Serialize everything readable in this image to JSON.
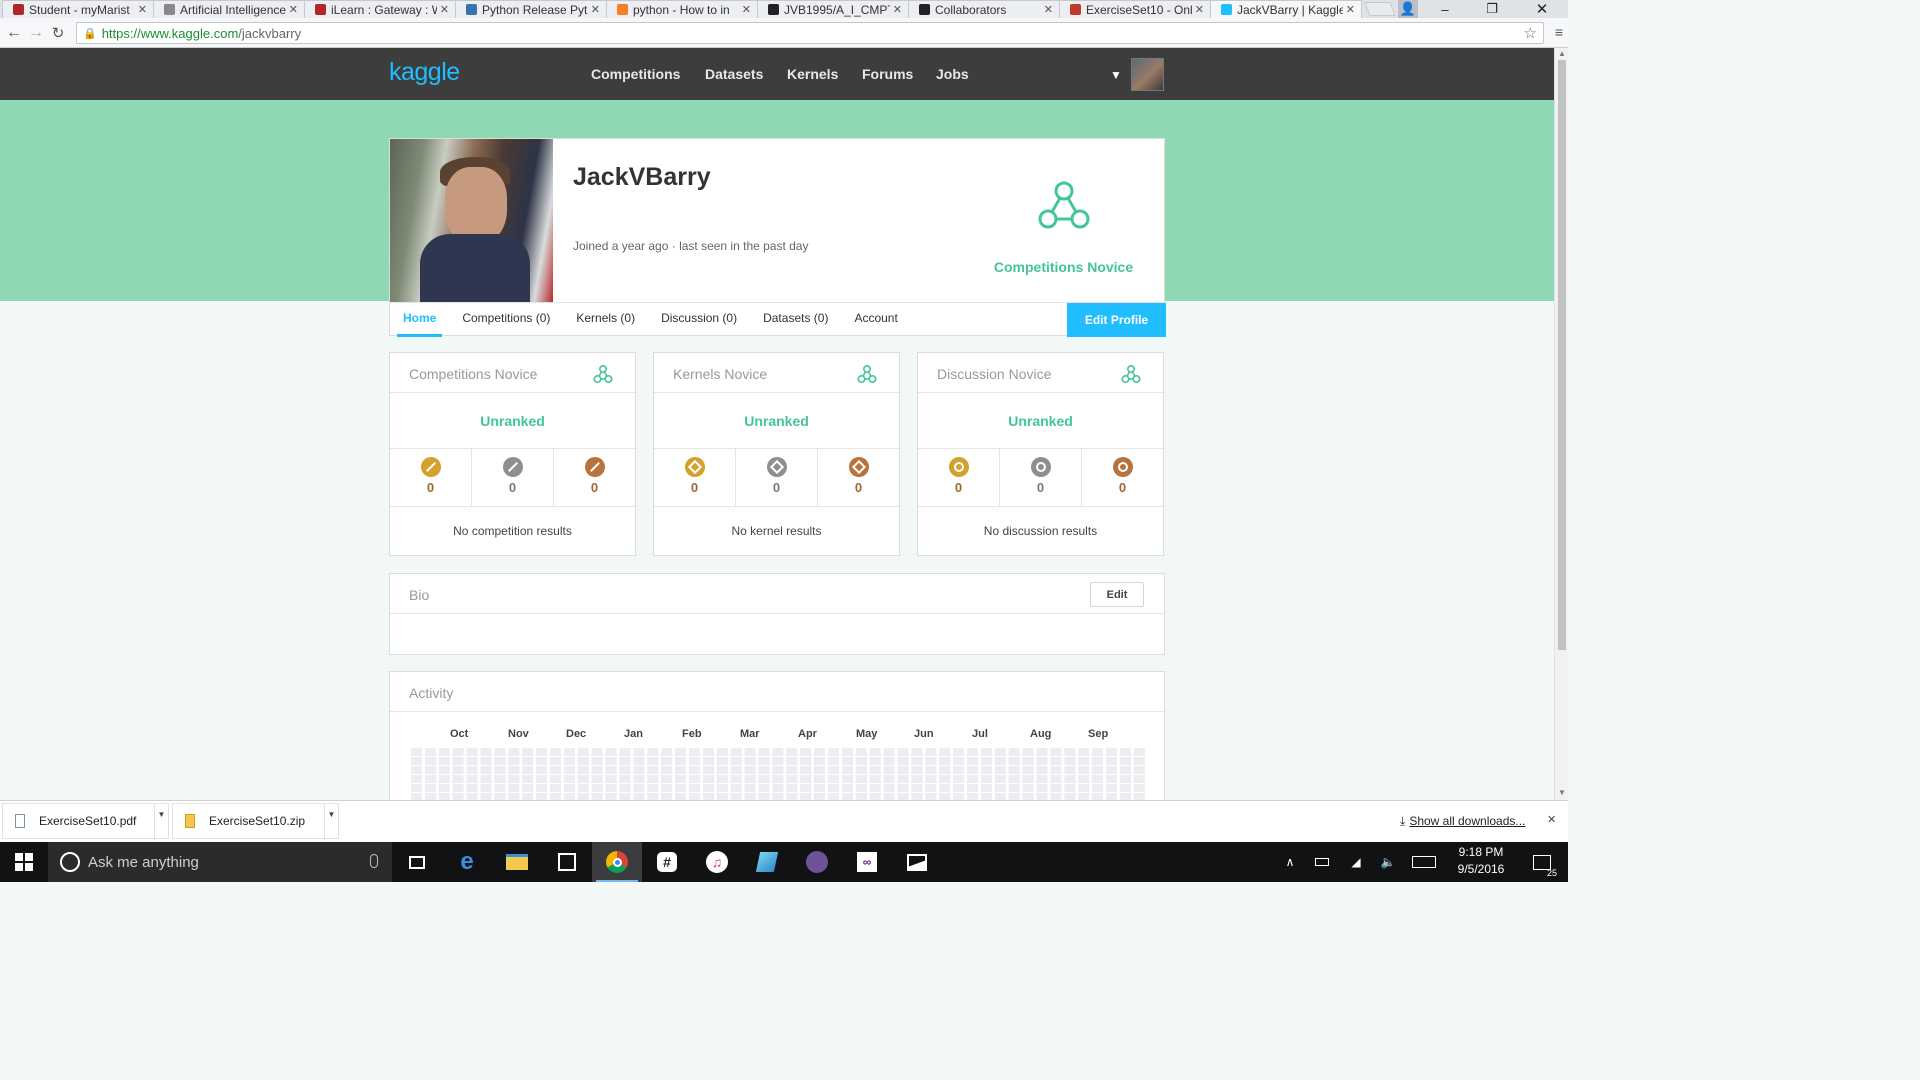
{
  "browser": {
    "tabs": [
      {
        "title": "Student - myMarist",
        "favicon_color": "#b0282a",
        "active": false
      },
      {
        "title": "Artificial Intelligence",
        "favicon_color": "#888888",
        "active": false
      },
      {
        "title": "iLearn : Gateway : W",
        "favicon_color": "#b0282a",
        "active": false
      },
      {
        "title": "Python Release Pyth",
        "favicon_color": "#3a74b0",
        "active": false
      },
      {
        "title": "python - How to in",
        "favicon_color": "#f48024",
        "active": false
      },
      {
        "title": "JVB1995/A_I_CMPT",
        "favicon_color": "#222222",
        "active": false
      },
      {
        "title": "Collaborators",
        "favicon_color": "#222222",
        "active": false
      },
      {
        "title": "ExerciseSet10 - Onl",
        "favicon_color": "#c0392b",
        "active": false
      },
      {
        "title": "JackVBarry | Kaggle",
        "favicon_color": "#20beff",
        "active": true
      }
    ],
    "url_scheme": "https://",
    "url_host": "www.kaggle.com",
    "url_path": "/jackvbarry",
    "back_icon": "arrow-left-icon",
    "forward_icon": "arrow-right-icon",
    "reload_icon": "reload-icon",
    "star_icon": "star-icon"
  },
  "site": {
    "logo": "kaggle",
    "nav": [
      "Competitions",
      "Datasets",
      "Kernels",
      "Forums",
      "Jobs"
    ]
  },
  "profile": {
    "username": "JackVBarry",
    "joined": "Joined a year ago · last seen in the past day",
    "tier": "Competitions Novice",
    "tier_color": "#43c596",
    "tabs": [
      "Home",
      "Competitions (0)",
      "Kernels (0)",
      "Discussion (0)",
      "Datasets (0)",
      "Account"
    ],
    "active_tab": "Home",
    "edit_profile": "Edit Profile"
  },
  "tiers": [
    {
      "title": "Competitions Novice",
      "rank": "Unranked",
      "medals": [
        {
          "kind": "gold",
          "count": "0",
          "color": "#d4a12a"
        },
        {
          "kind": "silver",
          "count": "0",
          "color": "#8f8f8f"
        },
        {
          "kind": "bronze",
          "count": "0",
          "color": "#b8733d"
        }
      ],
      "empty": "No competition results"
    },
    {
      "title": "Kernels Novice",
      "rank": "Unranked",
      "medals": [
        {
          "kind": "gold",
          "count": "0",
          "color": "#d4a12a"
        },
        {
          "kind": "silver",
          "count": "0",
          "color": "#8f8f8f"
        },
        {
          "kind": "bronze",
          "count": "0",
          "color": "#b8733d"
        }
      ],
      "empty": "No kernel results"
    },
    {
      "title": "Discussion Novice",
      "rank": "Unranked",
      "medals": [
        {
          "kind": "gold",
          "count": "0",
          "color": "#d4a12a"
        },
        {
          "kind": "silver",
          "count": "0",
          "color": "#8f8f8f"
        },
        {
          "kind": "bronze",
          "count": "0",
          "color": "#b8733d"
        }
      ],
      "empty": "No discussion results"
    }
  ],
  "bio": {
    "title": "Bio",
    "edit": "Edit"
  },
  "activity": {
    "title": "Activity",
    "months": [
      "Oct",
      "Nov",
      "Dec",
      "Jan",
      "Feb",
      "Mar",
      "Apr",
      "May",
      "Jun",
      "Jul",
      "Aug",
      "Sep"
    ]
  },
  "downloads": {
    "items": [
      "ExerciseSet10.pdf",
      "ExerciseSet10.zip"
    ],
    "show_all": "Show all downloads..."
  },
  "taskbar": {
    "search_placeholder": "Ask me anything",
    "time": "9:18 PM",
    "date": "9/5/2016",
    "notifications": "25",
    "pinned_icons": [
      "task-view-icon",
      "edge-icon",
      "file-explorer-icon",
      "store-icon",
      "chrome-icon",
      "slack-icon",
      "itunes-icon",
      "app-icon",
      "github-icon",
      "visual-studio-icon",
      "photos-icon"
    ]
  }
}
